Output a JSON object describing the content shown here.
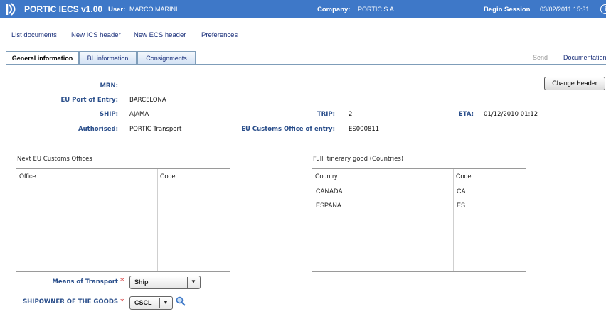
{
  "header": {
    "app_title": "PORTIC IECS v1.00",
    "user_label": "User:",
    "user_value": "MARCO MARINI",
    "company_label": "Company:",
    "company_value": "PORTIC S.A.",
    "session_label": "Begin Session",
    "session_value": "03/02/2011 15:31",
    "info_glyph": "i"
  },
  "nav": [
    "List documents",
    "New ICS header",
    "New ECS header",
    "Preferences"
  ],
  "tabs": [
    "General information",
    "BL information",
    "Consignments"
  ],
  "right_links": {
    "send": "Send",
    "documentation": "Documentation"
  },
  "change_header_button": "Change Header",
  "fields": {
    "mrn_label": "MRN:",
    "mrn_value": "",
    "port_label": "EU Port of Entry:",
    "port_value": "BARCELONA",
    "ship_label": "SHIP:",
    "ship_value": "AJAMA",
    "trip_label": "TRIP:",
    "trip_value": "2",
    "eta_label": "ETA:",
    "eta_value": "01/12/2010 01:12",
    "authorised_label": "Authorised:",
    "authorised_value": "PORTIC Transport",
    "customs_label": "EU Customs Office of entry:",
    "customs_value": "ES000811"
  },
  "offices": {
    "title": "Next EU Customs Offices",
    "columns": [
      "Office",
      "Code"
    ],
    "rows": []
  },
  "itinerary": {
    "title": "Full itinerary good (Countries)",
    "columns": [
      "Country",
      "Code"
    ],
    "rows": [
      {
        "country": "CANADA",
        "code": "CA"
      },
      {
        "country": "ESPAÑA",
        "code": "ES"
      }
    ]
  },
  "transport": {
    "label": "Means of Transport",
    "value": "Ship",
    "required_mark": "*"
  },
  "shipowner": {
    "label": "SHIPOWNER OF THE GOODS",
    "value": "CSCL",
    "required_mark": "*"
  },
  "colors": {
    "header_bg": "#3e78c8",
    "label_color": "#2b4f8b",
    "required": "#d02020"
  }
}
